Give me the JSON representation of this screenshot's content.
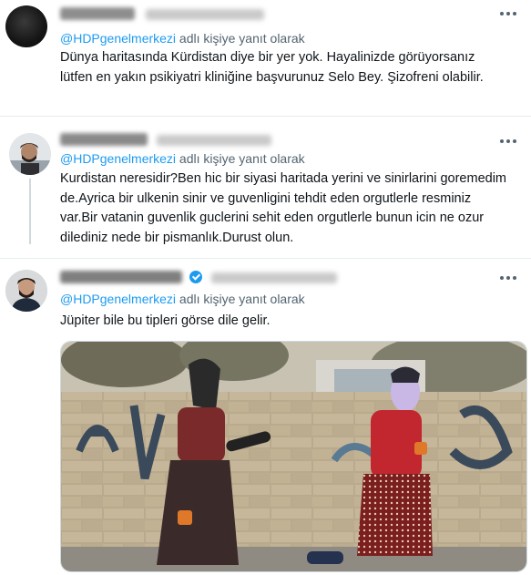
{
  "tweets": [
    {
      "reply_prefix": "@HDPgenelmerkezi",
      "reply_suffix": " adlı kişiye yanıt olarak",
      "text_lines": [
        "Dünya haritasında Kürdistan diye bir yer yok. Hayalinizde görüyorsanız",
        "lütfen en yakın psikiyatri kliniğine başvurunuz Selo Bey. Şizofreni olabilir."
      ]
    },
    {
      "reply_prefix": "@HDPgenelmerkezi",
      "reply_suffix": " adlı kişiye yanıt olarak",
      "text_lines": [
        "Kurdistan neresidir?Ben hic bir siyasi haritada yerini ve sinirlarini goremedim",
        "de.Ayrica bir ulkenin sinir ve guvenligini tehdit eden orgutlerle resminiz",
        "var.Bir vatanin guvenlik guclerini sehit eden orgutlerle bunun icin ne ozur",
        "dilediniz nede bir pismanlık.Durust olun."
      ]
    },
    {
      "reply_prefix": "@HDPgenelmerkezi",
      "reply_suffix": " adlı kişiye yanıt olarak",
      "text_lines": [
        "Jüpiter bile bu tipleri görse dile gelir."
      ]
    }
  ],
  "colors": {
    "mention": "#1d9bf0",
    "secondary_text": "#536471",
    "divider": "#e6ecf0",
    "verified": "#1d9bf0"
  },
  "icons": {
    "more": "more-horizontal-icon",
    "verified": "verified-badge-icon"
  }
}
